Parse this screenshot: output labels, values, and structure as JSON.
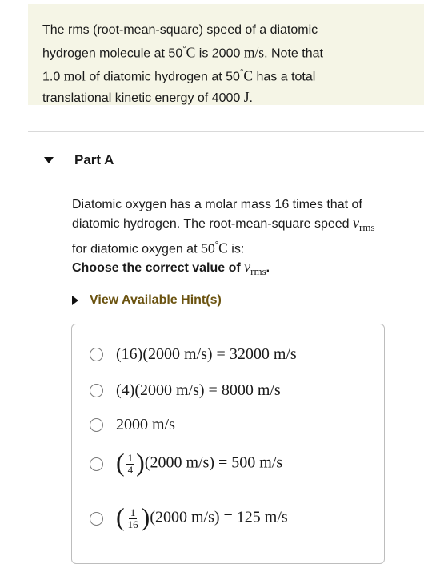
{
  "intro": {
    "l1_a": "The rms (root-mean-square) speed of a diatomic",
    "l2_a": "hydrogen molecule at 50",
    "l2_deg": "°",
    "l2_c": "C",
    "l2_b": " is 2000 ",
    "l2_unit": "m/s",
    "l2_c2": ". Note that",
    "l3_a": "1.0 ",
    "l3_unit": "mol",
    "l3_b": " of diatomic hydrogen at 50",
    "l3_deg": "°",
    "l3_c": "C",
    "l3_d": " has a total",
    "l4_a": "translational kinetic energy of 4000 ",
    "l4_unit": "J",
    "l4_b": "."
  },
  "part": {
    "title": "Part A"
  },
  "question": {
    "l1": "Diatomic oxygen has a molar mass 16 times that of",
    "l2_a": "diatomic hydrogen. The root-mean-square speed ",
    "l2_var": "v",
    "l2_sub": "rms",
    "l3_a": "for diatomic oxygen at 50",
    "l3_deg": "°",
    "l3_c": "C",
    "l3_b": " is:"
  },
  "instruction": {
    "text": "Choose the correct value of ",
    "var": "v",
    "sub": "rms",
    "end": "."
  },
  "hint": {
    "label": "View Available Hint(s)"
  },
  "options": [
    {
      "text": "(16)(2000 m/s) = 32000 m/s"
    },
    {
      "text": "(4)(2000 m/s) = 8000 m/s"
    },
    {
      "text": "2000 m/s"
    },
    {
      "num": "1",
      "den": "4",
      "rest": "(2000 m/s) = 500 m/s"
    },
    {
      "num": "1",
      "den": "16",
      "rest": "(2000 m/s) = 125 m/s"
    }
  ]
}
